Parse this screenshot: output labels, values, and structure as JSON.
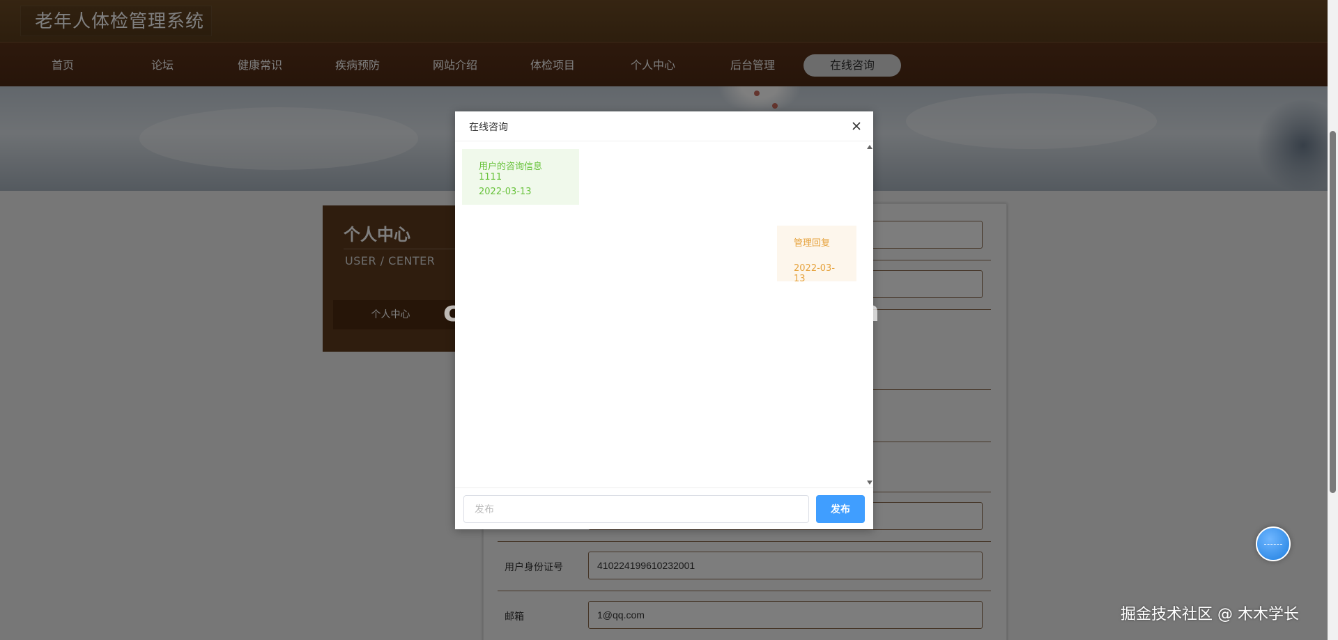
{
  "header": {
    "logo_title": "老年人体检管理系统"
  },
  "nav": {
    "items": [
      {
        "label": "首页"
      },
      {
        "label": "论坛"
      },
      {
        "label": "健康常识"
      },
      {
        "label": "疾病预防"
      },
      {
        "label": "网站介绍"
      },
      {
        "label": "体检项目"
      },
      {
        "label": "个人中心"
      },
      {
        "label": "后台管理"
      },
      {
        "label": "在线咨询",
        "active": true
      }
    ]
  },
  "sidebar": {
    "title": "个人中心",
    "subtitle": "USER / CENTER",
    "button_label": "个人中心"
  },
  "form": {
    "rows": [
      {
        "label": "",
        "value": ""
      },
      {
        "label": "",
        "value": ""
      },
      {
        "label": "",
        "value": ""
      },
      {
        "label": "",
        "value": ""
      },
      {
        "label": "",
        "value": ""
      },
      {
        "label": "",
        "value": ""
      },
      {
        "label": "用户身份证号",
        "value": "410224199610232001"
      },
      {
        "label": "邮箱",
        "value": "1@qq.com"
      }
    ]
  },
  "dialog": {
    "title": "在线咨询",
    "messages": [
      {
        "role": "user",
        "text": "用户的咨询信息1111",
        "date": "2022-03-13"
      },
      {
        "role": "admin",
        "text": "管理回复",
        "date": "2022-03-13"
      }
    ],
    "input_placeholder": "发布",
    "send_label": "发布"
  },
  "watermarks": {
    "center": "cn围观客www.weiguanke.cn",
    "corner": "掘金技术社区 @ 木木学长"
  },
  "colors": {
    "header_brown": "#6c4a24",
    "nav_brown": "#4e2a14",
    "user_msg_bg": "#f0f9eb",
    "user_msg_text": "#67c23a",
    "admin_msg_bg": "#fdf6ec",
    "admin_msg_text": "#e6a23c",
    "primary_button": "#409eff"
  }
}
